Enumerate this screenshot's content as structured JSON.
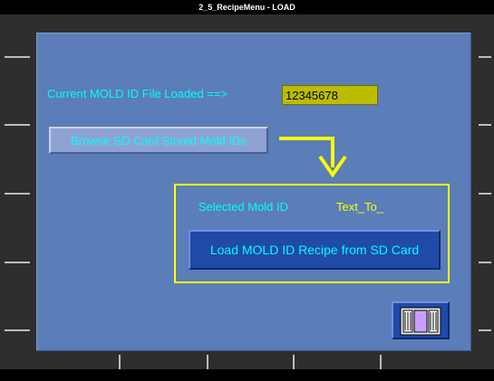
{
  "window": {
    "title": "2_5_RecipeMenu - LOAD"
  },
  "current_mold": {
    "label": "Current MOLD ID File Loaded ==>",
    "value": "12345678"
  },
  "browse_button": {
    "label": "Browse SD Card Stored Mold IDs"
  },
  "selection": {
    "label": "Selected Mold ID",
    "value": "Text_To_"
  },
  "load_button": {
    "label": "Load MOLD ID Recipe from SD Card"
  },
  "exit_button": {
    "icon": "exit-door-icon"
  },
  "colors": {
    "panel": "#5b7db8",
    "label_text": "#00ffff",
    "highlight": "#ffff00",
    "value_field": "#bcbc00",
    "button_blue": "#1f4aa8"
  }
}
